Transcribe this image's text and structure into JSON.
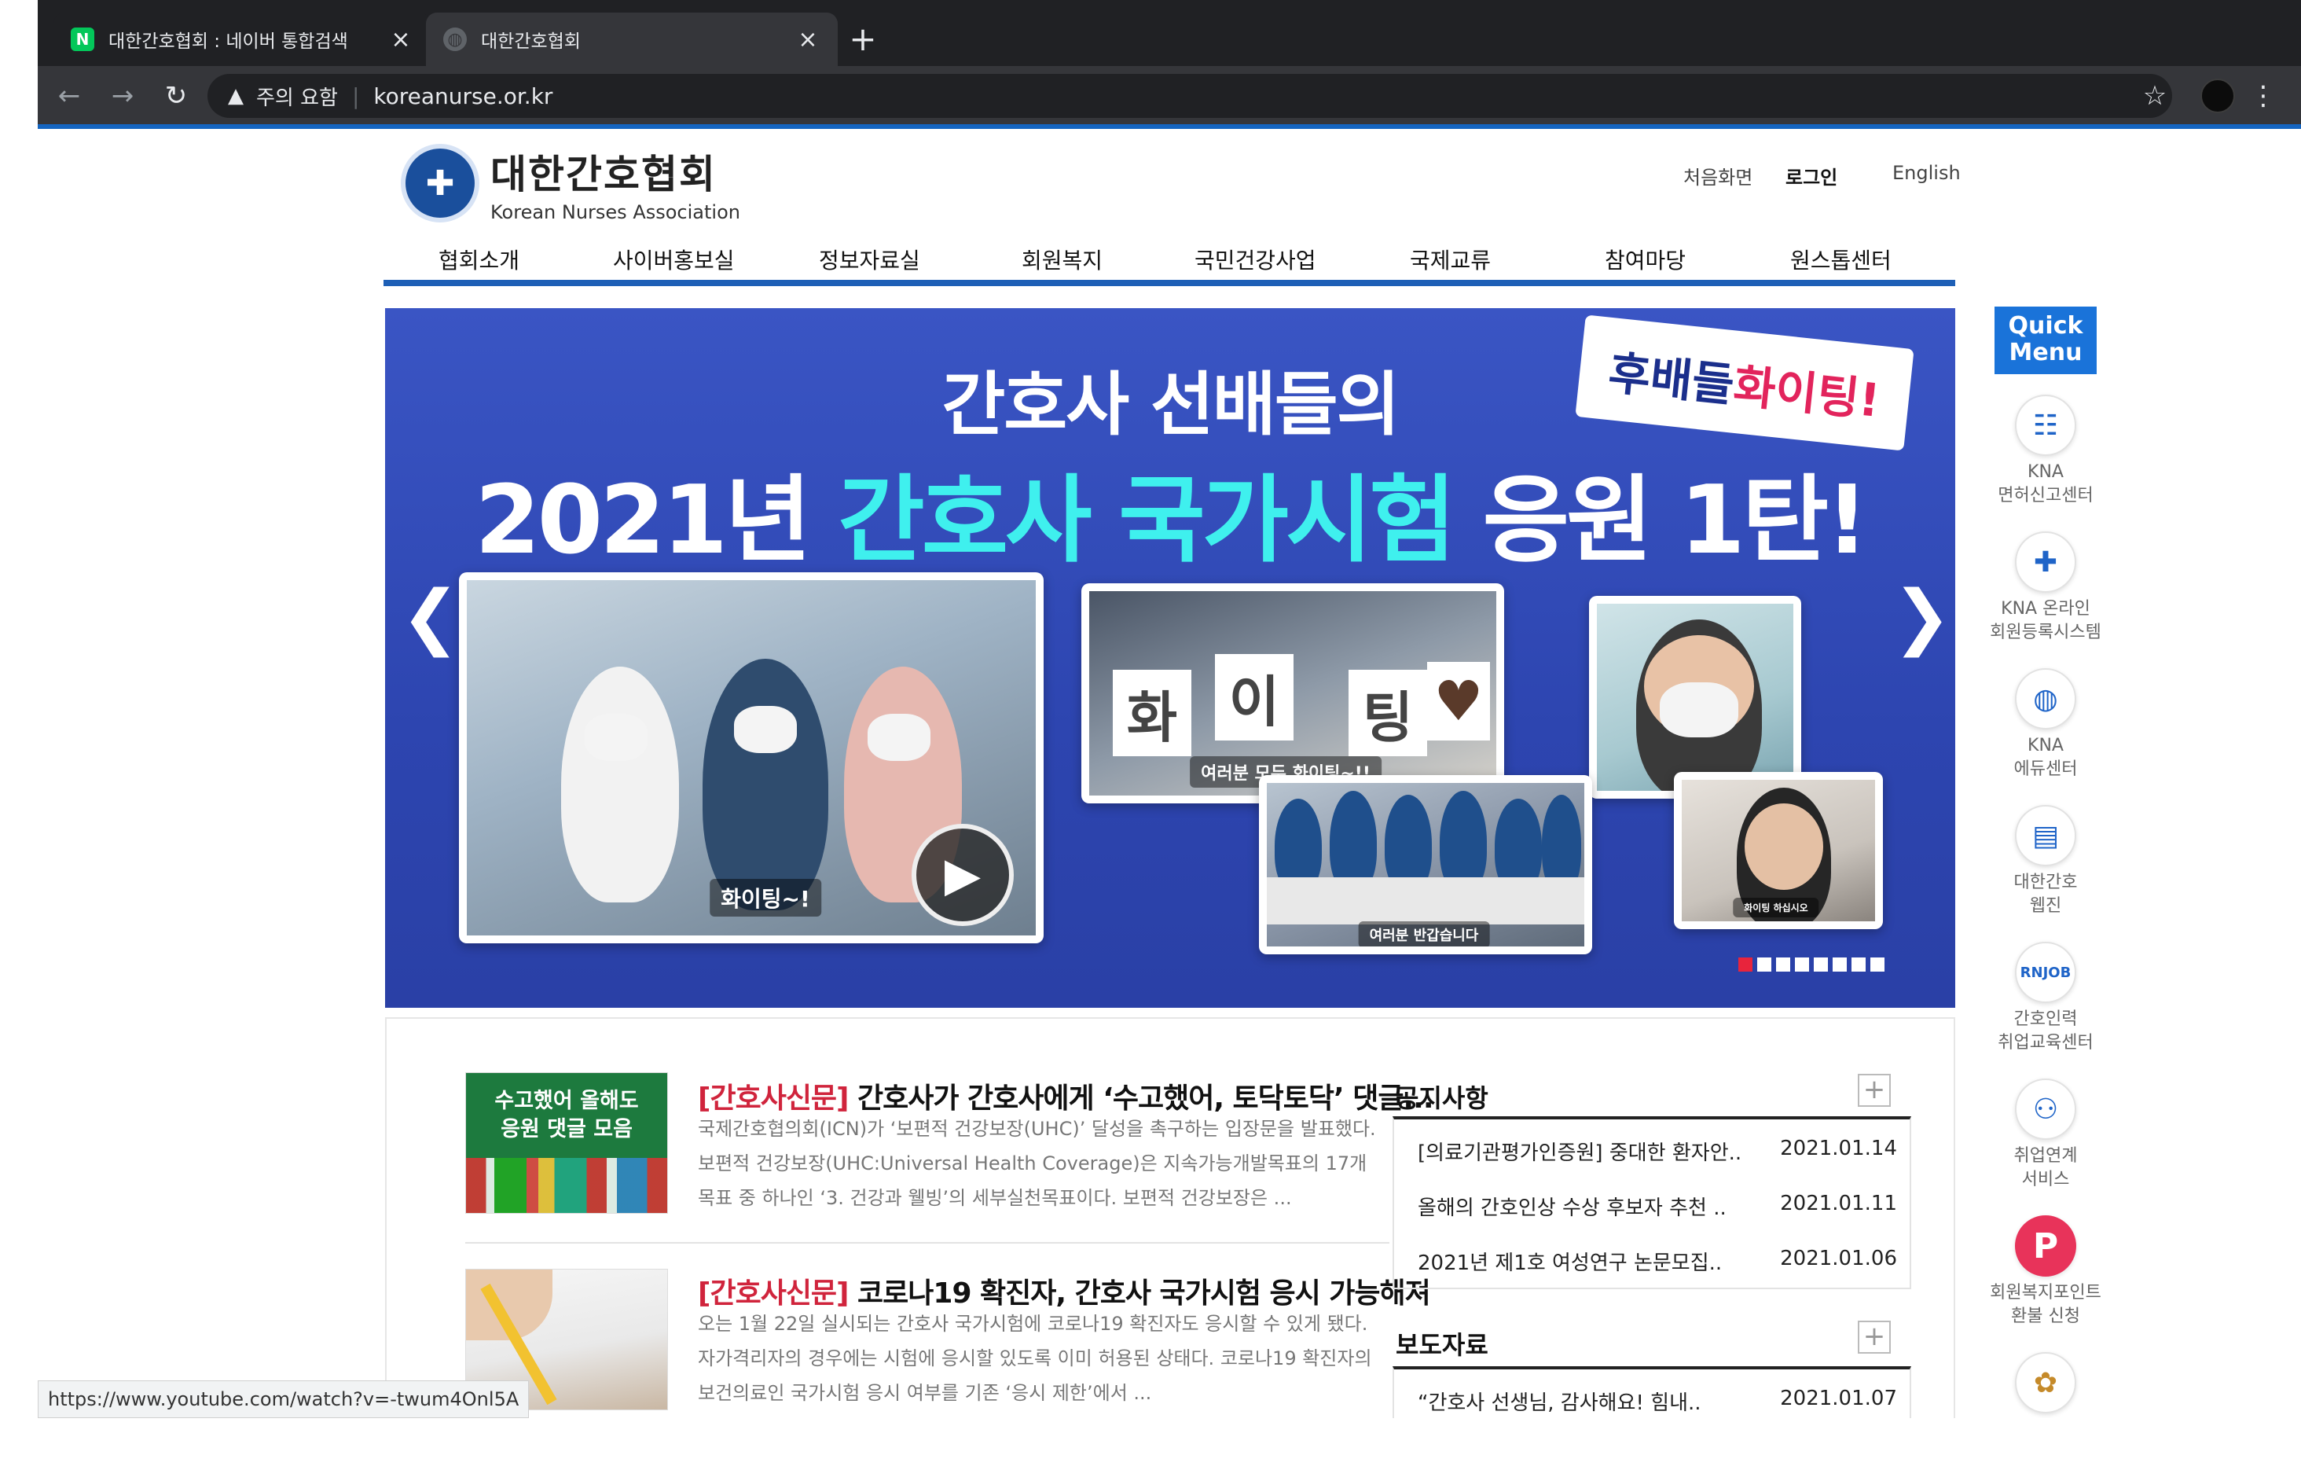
{
  "browser": {
    "tabs": [
      {
        "title": "대한간호협회 : 네이버 통합검색",
        "favicon": "N",
        "favicon_color": "#03c75a"
      },
      {
        "title": "대한간호협회",
        "favicon": "globe-icon"
      }
    ],
    "new_tab": "+",
    "security_text": "주의 요함",
    "url": "koreanurse.or.kr",
    "status_url": "https://www.youtube.com/watch?v=-twum4Onl5A"
  },
  "header": {
    "logo_ko": "대한간호협회",
    "logo_en": "Korean Nurses Association",
    "utility": [
      "처음화면",
      "로그인",
      "English"
    ]
  },
  "gnb": [
    "협회소개",
    "사이버홍보실",
    "정보자료실",
    "회원복지",
    "국민건강사업",
    "국제교류",
    "참여마당",
    "원스톱센터"
  ],
  "banner": {
    "title1": "간호사 선배들의",
    "title2_part1": "2021년 ",
    "title2_part2": "간호사 국가시험",
    "title2_part3": " 응원 1탄!",
    "flag_part1": "후배들 ",
    "flag_part2": "화이팅!",
    "photo1_caption": "화이팅~!",
    "photo2_signs": [
      "화",
      "이",
      "팅",
      "♥"
    ],
    "photo2_caption": "여러분 모두 화이팅~!!",
    "photo4_caption": "여러분 반갑습니다",
    "photo5_caption": "화이팅 하십시오",
    "accent_color": "#3ff0ee"
  },
  "news": [
    {
      "tag": "[간호사신문]",
      "title": " 간호사가 간호사에게 ‘수고했어, 토닥토닥’ 댓글...",
      "summary": "국제간호협의회(ICN)가 ‘보편적 건강보장(UHC)’ 달성을 촉구하는 입장문을 발표했다. 보편적 건강보장(UHC:Universal Health Coverage)은 지속가능개발목표의 17개 목표 중 하나인 ‘3. 건강과 웰빙’의 세부실천목표이다. 보편적 건강보장은 ...",
      "thumb_text": "수고했어 올해도\n응원 댓글 모음"
    },
    {
      "tag": "[간호사신문]",
      "title": " 코로나19 확진자, 간호사 국가시험 응시 가능해져",
      "summary": "오는 1월 22일 실시되는 간호사 국가시험에 코로나19 확진자도 응시할 수 있게 됐다. 자가격리자의 경우에는 시험에 응시할 있도록 이미 허용된 상태다. 코로나19 확진자의 보건의료인 국가시험 응시 여부를 기존 ‘응시 제한’에서 ..."
    }
  ],
  "boards": [
    {
      "title": "공지사항",
      "plus": "+",
      "rows": [
        {
          "title": "[의료기관평가인증원] 중대한 환자안..",
          "date": "2021.01.14"
        },
        {
          "title": "올해의 간호인상 수상 후보자 추천 ..",
          "date": "2021.01.11"
        },
        {
          "title": "2021년 제1호 여성연구 논문모집..",
          "date": "2021.01.06"
        }
      ]
    },
    {
      "title": "보도자료",
      "plus": "+",
      "rows": [
        {
          "title": "“간호사 선생님, 감사해요! 힘내..",
          "date": "2021.01.07"
        }
      ]
    }
  ],
  "quick_menu": {
    "head": "Quick\nMenu",
    "items": [
      {
        "label": "KNA\n면허신고센터",
        "icon": "license-icon",
        "glyph": "☷"
      },
      {
        "label": "KNA 온라인\n회원등록시스템",
        "icon": "user-add-icon",
        "glyph": "👤"
      },
      {
        "label": "KNA\n에듀센터",
        "icon": "globe-icon",
        "glyph": "◍"
      },
      {
        "label": "대한간호\n웹진",
        "icon": "newspaper-icon",
        "glyph": "▤"
      },
      {
        "label": "간호인력\n취업교육센터",
        "icon": "rnjob-icon",
        "glyph": "RNJOB"
      },
      {
        "label": "취업연계\n서비스",
        "icon": "people-icon",
        "glyph": "👥"
      },
      {
        "label": "회원복지포인트\n환불 신청",
        "icon": "point-icon",
        "glyph": "P"
      },
      {
        "label": "",
        "icon": "emblem-icon",
        "glyph": "✿"
      }
    ]
  }
}
